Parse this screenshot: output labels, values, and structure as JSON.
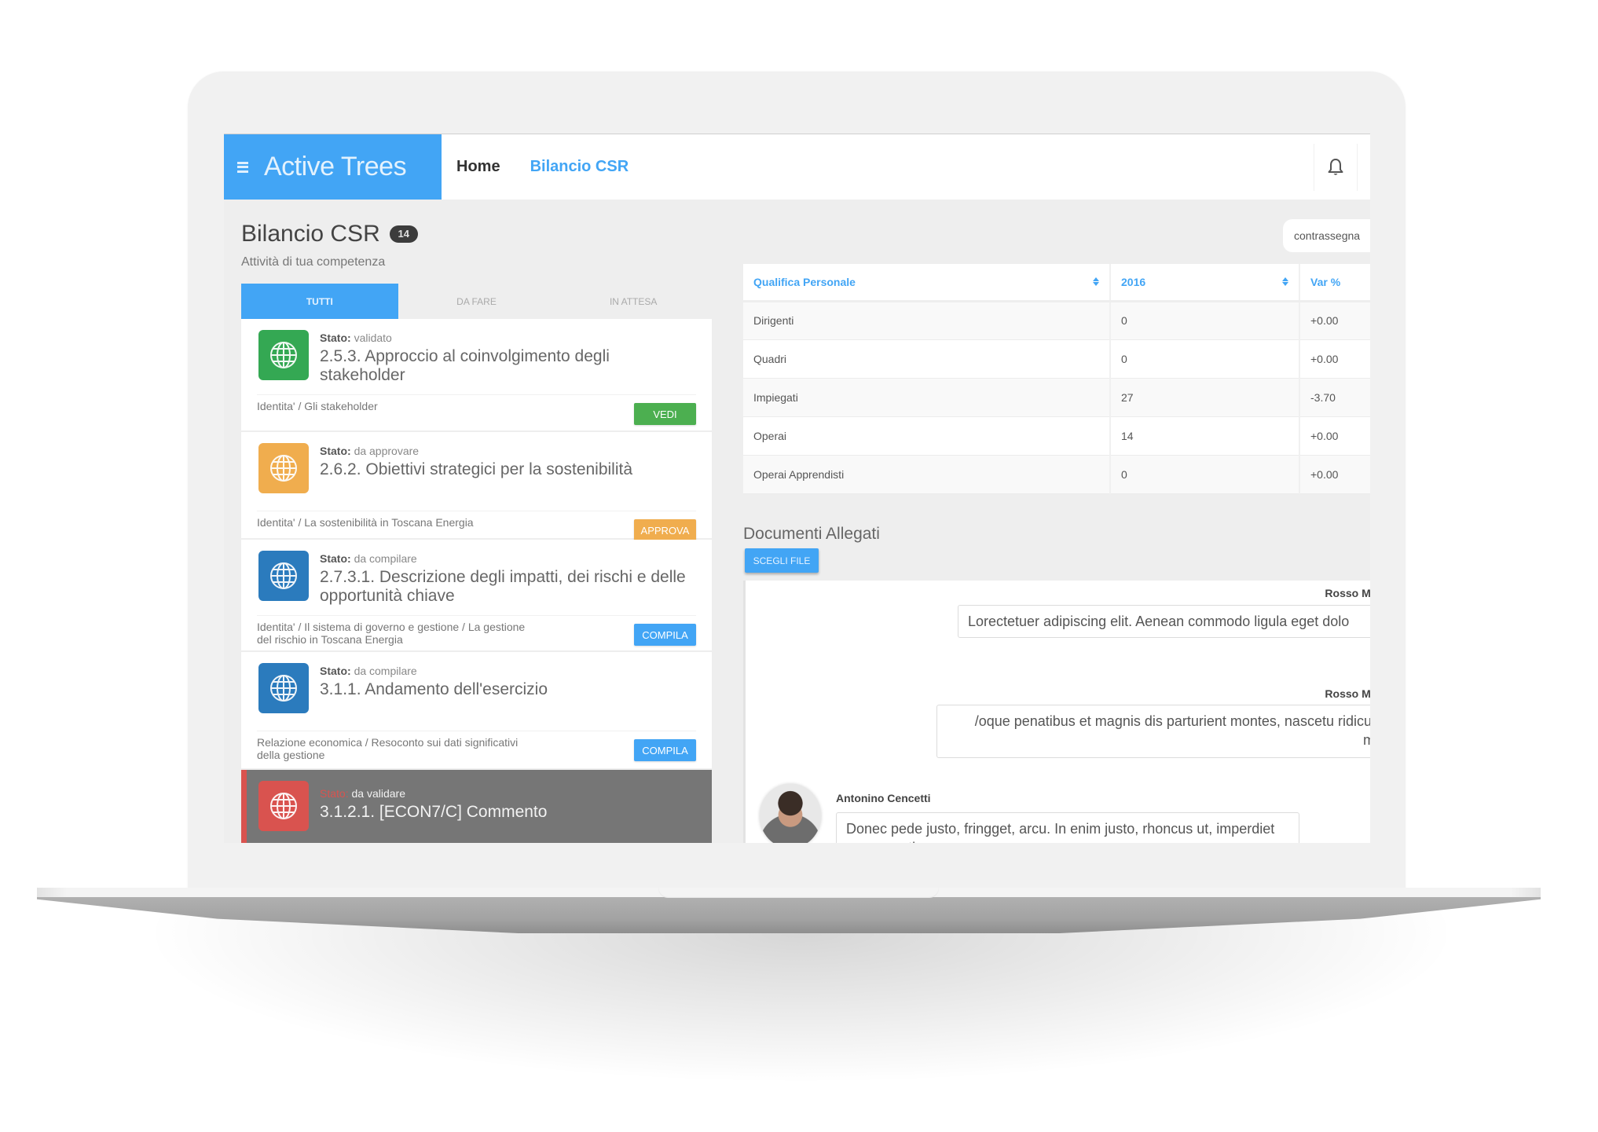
{
  "app": {
    "title": "Active Trees",
    "menu_icon": "hamburger-icon",
    "brand_color": "#42a5f5"
  },
  "nav": {
    "items": [
      {
        "label": "Home",
        "active": false
      },
      {
        "label": "Bilancio CSR",
        "active": true
      }
    ],
    "notifications_icon": "bell-icon"
  },
  "page": {
    "title": "Bilancio CSR",
    "count": "14",
    "subtitle": "Attività di tua competenza",
    "flag_button": "contrassegna"
  },
  "tabs": [
    {
      "label": "TUTTI",
      "active": true
    },
    {
      "label": "DA FARE",
      "active": false
    },
    {
      "label": "IN ATTESA",
      "active": false
    }
  ],
  "tasks": [
    {
      "status_label": "Stato:",
      "status": "validato",
      "title": "2.5.3. Approccio al coinvolgimento degli stakeholder",
      "breadcrumb": "Identita' / Gli stakeholder",
      "action": "VEDI",
      "icon": "globe-icon",
      "color": "#34a853"
    },
    {
      "status_label": "Stato:",
      "status": "da approvare",
      "title": "2.6.2. Obiettivi strategici per la sostenibilità",
      "breadcrumb": "Identita' / La sostenibilità in Toscana Energia",
      "action": "APPROVA",
      "icon": "globe-icon",
      "color": "#f0ad4e"
    },
    {
      "status_label": "Stato:",
      "status": "da compilare",
      "title": "2.7.3.1. Descrizione degli impatti, dei rischi e delle opportunità chiave",
      "breadcrumb": "Identita' / Il sistema di governo e gestione / La gestione del rischio in Toscana Energia",
      "action": "COMPILA",
      "icon": "globe-icon",
      "color": "#2b7bbd"
    },
    {
      "status_label": "Stato:",
      "status": "da compilare",
      "title": "3.1.1. Andamento dell'esercizio",
      "breadcrumb": "Relazione economica / Resoconto sui dati significativi della gestione",
      "action": "COMPILA",
      "icon": "globe-icon",
      "color": "#2b7bbd"
    },
    {
      "status_label": "Stato:",
      "status": "da validare",
      "title": "3.1.2.1. [ECON7/C] Commento",
      "icon": "globe-icon",
      "color": "#d9534f",
      "selected": true
    }
  ],
  "action_colors": {
    "VEDI": "#4caf50",
    "APPROVA": "#f0ad4e",
    "COMPILA": "#42a5f5"
  },
  "table": {
    "headers": [
      "Qualifica Personale",
      "2016",
      "Var %"
    ],
    "rows": [
      [
        "Dirigenti",
        "0",
        "+0.00"
      ],
      [
        "Quadri",
        "0",
        "+0.00"
      ],
      [
        "Impiegati",
        "27",
        "-3.70"
      ],
      [
        "Operai",
        "14",
        "+0.00"
      ],
      [
        "Operai Apprendisti",
        "0",
        "+0.00"
      ]
    ]
  },
  "documents": {
    "title": "Documenti Allegati",
    "choose_file": "SCEGLI FILE"
  },
  "comments": [
    {
      "author": "Rosso Mar",
      "text": "Lorectetuer adipiscing elit. Aenean commodo ligula eget dolo"
    },
    {
      "author": "Rosso Mar",
      "text": "/oque penatibus et magnis dis parturient montes, nascetu ridiculus mus"
    },
    {
      "author": "Antonino Cencetti",
      "text": "Donec pede justo, fringget, arcu. In enim justo, rhoncus ut, imperdiet a, venenatis"
    }
  ]
}
